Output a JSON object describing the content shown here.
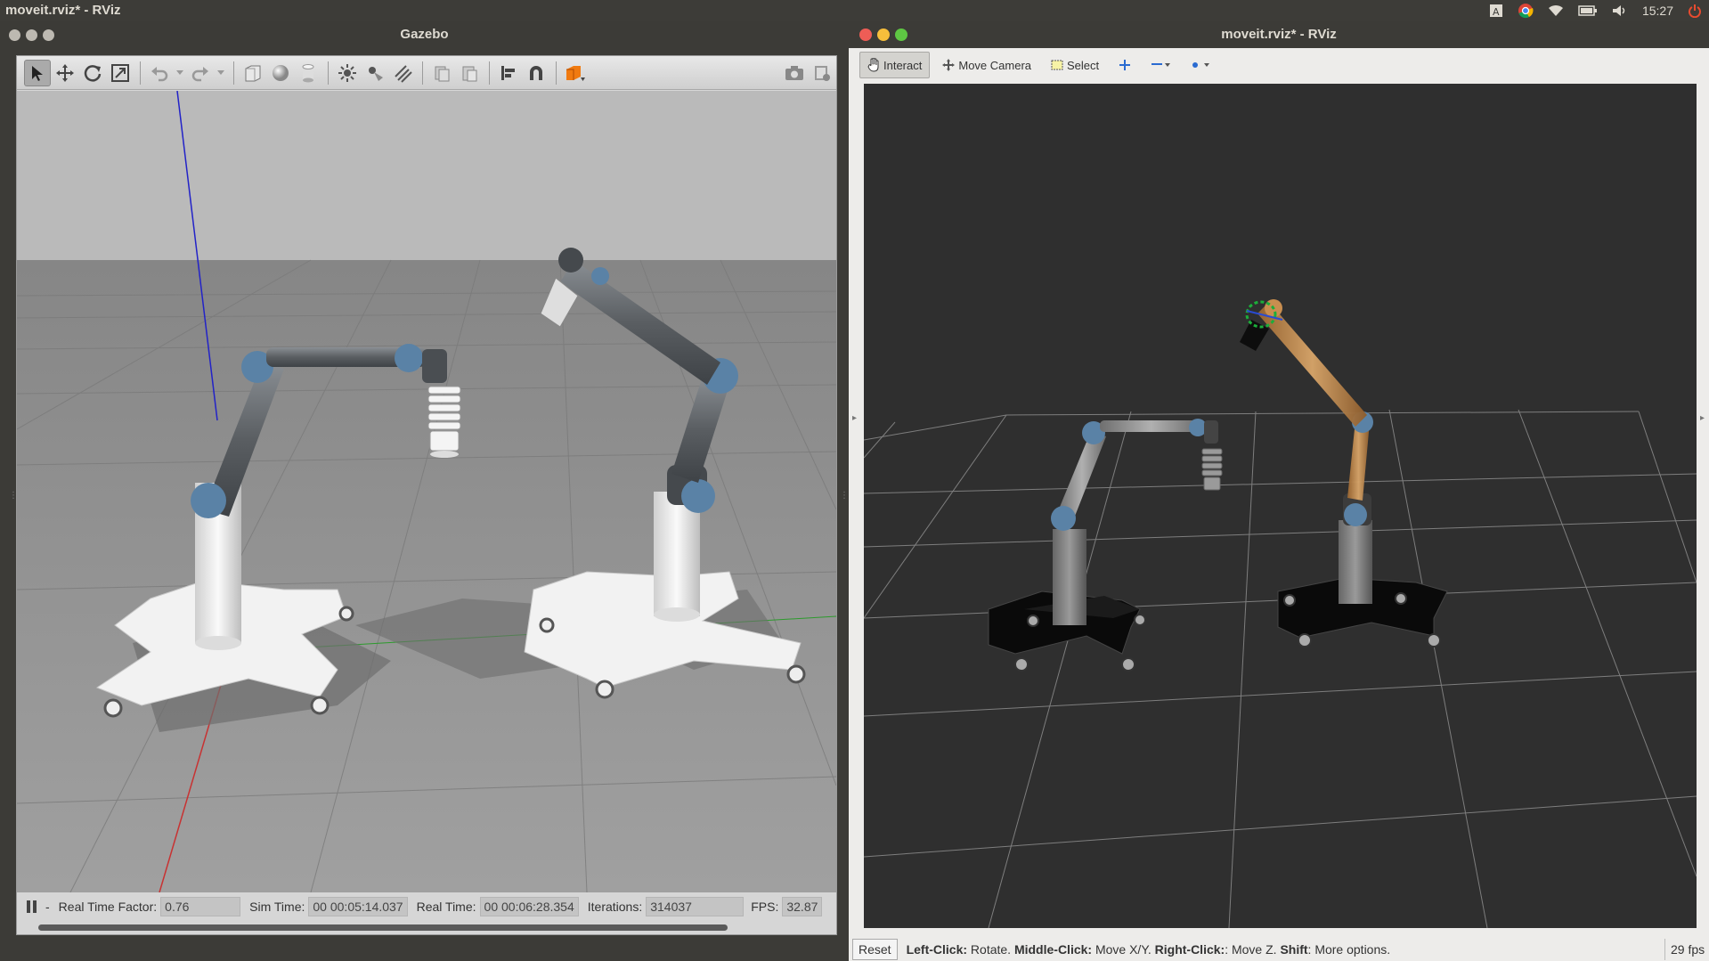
{
  "top_bar": {
    "title": "moveit.rviz* - RViz",
    "clock": "15:27",
    "indicators": [
      "keyboard-layout-icon",
      "chrome-icon",
      "wifi-icon",
      "battery-icon",
      "volume-icon",
      "power-icon"
    ]
  },
  "gazebo": {
    "window_title": "Gazebo",
    "toolbar_icons": [
      "select-mode-icon",
      "translate-mode-icon",
      "rotate-mode-icon",
      "scale-mode-icon",
      "undo-icon",
      "undo-history-icon",
      "redo-icon",
      "redo-history-icon",
      "box-shape-icon",
      "sphere-shape-icon",
      "cylinder-shape-icon",
      "point-light-icon",
      "spot-light-icon",
      "directional-light-icon",
      "copy-icon",
      "paste-icon",
      "align-icon",
      "snap-icon",
      "change-view-icon",
      "screenshot-icon",
      "record-log-icon"
    ],
    "status": {
      "real_time_factor_label": "Real Time Factor:",
      "real_time_factor": "0.76",
      "sim_time_label": "Sim Time:",
      "sim_time": "00 00:05:14.037",
      "real_time_label": "Real Time:",
      "real_time": "00 00:06:28.354",
      "iterations_label": "Iterations:",
      "iterations": "314037",
      "fps_label": "FPS:",
      "fps": "32.87"
    }
  },
  "rviz": {
    "window_title": "moveit.rviz* - RViz",
    "toolbar": {
      "interact": "Interact",
      "move_camera": "Move Camera",
      "select": "Select"
    },
    "status": {
      "reset": "Reset",
      "hint_left_click": "Left-Click:",
      "hint_rotate": " Rotate. ",
      "hint_middle_click": "Middle-Click:",
      "hint_move_xy": " Move X/Y. ",
      "hint_right_click": "Right-Click:",
      "hint_move_z": ": Move Z. ",
      "hint_shift": "Shift",
      "hint_more": ": More options.",
      "fps": "29 fps"
    }
  },
  "colors": {
    "gazebo_sky": "#b9b9b9",
    "gazebo_floor": "#8c8c8c",
    "rviz_background": "#2f2f2f",
    "traffic_close": "#ee5d56",
    "traffic_min": "#f6be3b",
    "traffic_max": "#5ec643",
    "goal_arm": "#c98e4f"
  }
}
